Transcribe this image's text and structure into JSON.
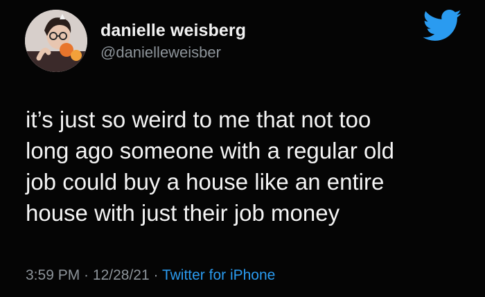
{
  "user": {
    "display_name": "danielle weisberg",
    "handle": "@danielleweisber"
  },
  "tweet": {
    "text": "it’s just so weird to me that not too\nlong ago someone with a regular old\njob could buy a house like an entire\nhouse with just their job money"
  },
  "meta": {
    "time": "3:59 PM",
    "separator": " · ",
    "date": "12/28/21",
    "source": "Twitter for iPhone"
  },
  "colors": {
    "background": "#050505",
    "text": "#f4f4f4",
    "muted": "#8d949a",
    "accent": "#2a9bf0"
  },
  "icons": {
    "logo": "twitter-bird-icon"
  }
}
